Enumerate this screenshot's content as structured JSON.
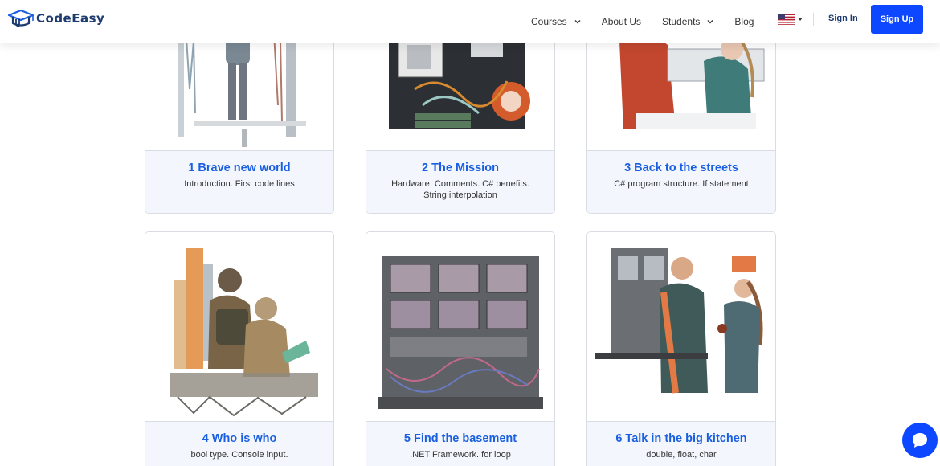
{
  "brand": {
    "name_part1": "Code",
    "name_part2": "Easy"
  },
  "nav": {
    "courses": "Courses",
    "about": "About Us",
    "students": "Students",
    "blog": "Blog",
    "language_flag": "us-flag-icon",
    "signin": "Sign In",
    "signup": "Sign Up"
  },
  "colors": {
    "accent": "#0d47ff",
    "title": "#1a5fe0",
    "card_body": "#f3f7fd"
  },
  "cards": [
    {
      "title": "1 Brave new world",
      "desc": "Introduction. First code lines"
    },
    {
      "title": "2 The Mission",
      "desc": "Hardware. Comments. C# benefits. String interpolation"
    },
    {
      "title": "3 Back to the streets",
      "desc": "C# program structure. If statement"
    },
    {
      "title": "4 Who is who",
      "desc": "bool type. Console input."
    },
    {
      "title": "5 Find the basement",
      "desc": ".NET Framework. for loop"
    },
    {
      "title": "6 Talk in the big kitchen",
      "desc": "double, float, char"
    }
  ],
  "chat": {
    "icon": "chat-bubble-icon"
  }
}
